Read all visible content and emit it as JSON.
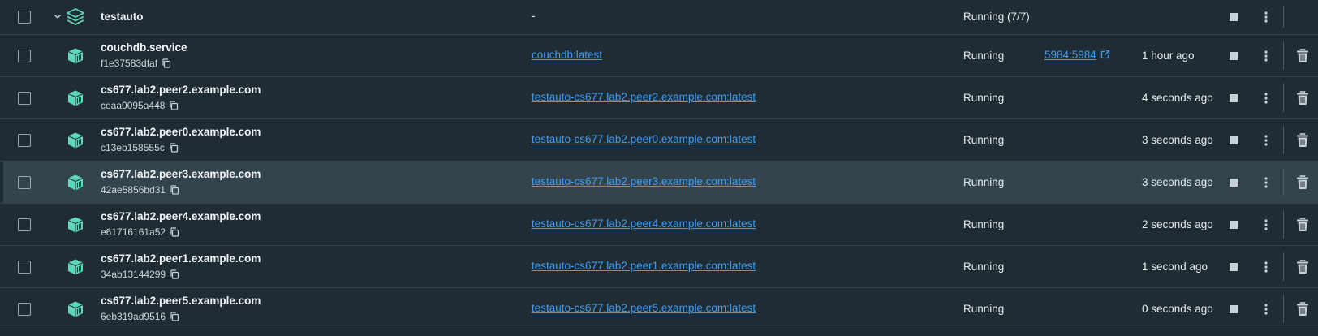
{
  "colors": {
    "background": "#202c33",
    "row_hover": "#34444c",
    "link": "#3d9cf6",
    "icon_accent": "#5fd7b8"
  },
  "group": {
    "name": "testauto",
    "image": "-",
    "status": "Running (7/7)"
  },
  "containers": [
    {
      "name": "couchdb.service",
      "id": "f1e37583dfaf",
      "image": "couchdb:latest",
      "status": "Running",
      "port": "5984:5984",
      "started": "1 hour ago"
    },
    {
      "name": "cs677.lab2.peer2.example.com",
      "id": "ceaa0095a448",
      "image": "testauto-cs677.lab2.peer2.example.com:latest",
      "status": "Running",
      "port": "",
      "started": "4 seconds ago"
    },
    {
      "name": "cs677.lab2.peer0.example.com",
      "id": "c13eb158555c",
      "image": "testauto-cs677.lab2.peer0.example.com:latest",
      "status": "Running",
      "port": "",
      "started": "3 seconds ago"
    },
    {
      "name": "cs677.lab2.peer3.example.com",
      "id": "42ae5856bd31",
      "image": "testauto-cs677.lab2.peer3.example.com:latest",
      "status": "Running",
      "port": "",
      "started": "3 seconds ago"
    },
    {
      "name": "cs677.lab2.peer4.example.com",
      "id": "e61716161a52",
      "image": "testauto-cs677.lab2.peer4.example.com:latest",
      "status": "Running",
      "port": "",
      "started": "2 seconds ago"
    },
    {
      "name": "cs677.lab2.peer1.example.com",
      "id": "34ab13144299",
      "image": "testauto-cs677.lab2.peer1.example.com:latest",
      "status": "Running",
      "port": "",
      "started": "1 second ago"
    },
    {
      "name": "cs677.lab2.peer5.example.com",
      "id": "6eb319ad9516",
      "image": "testauto-cs677.lab2.peer5.example.com:latest",
      "status": "Running",
      "port": "",
      "started": "0 seconds ago"
    }
  ]
}
